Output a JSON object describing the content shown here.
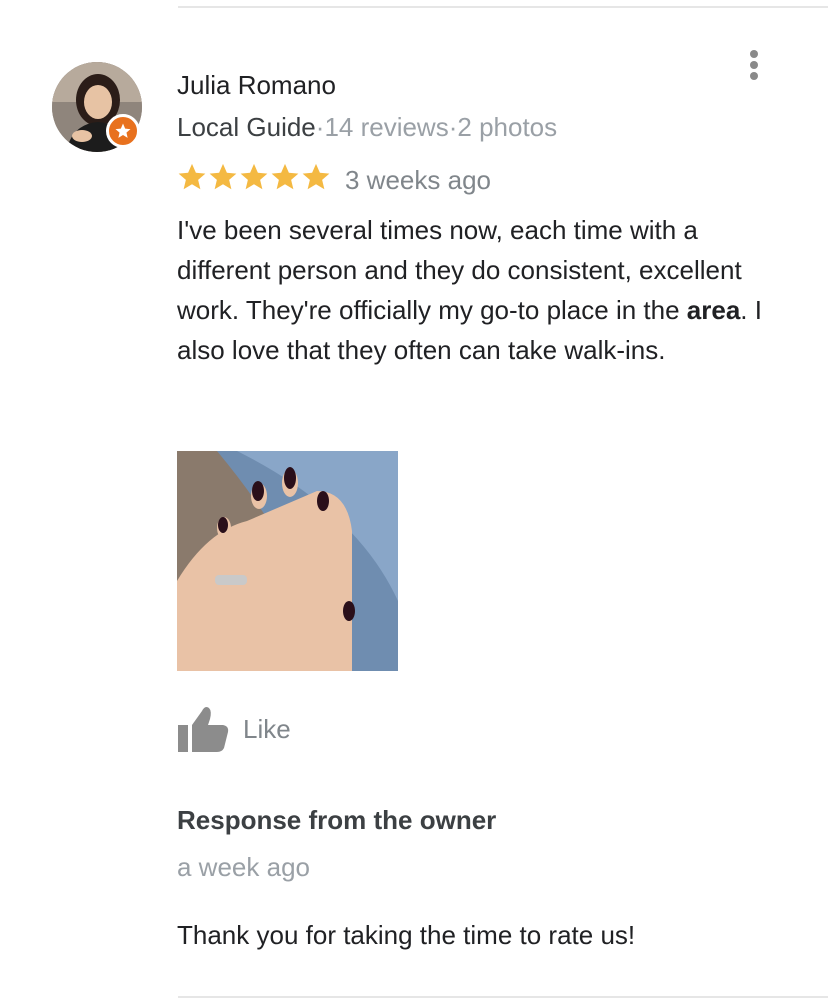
{
  "reviewer": {
    "name": "Julia Romano",
    "guide_label": "Local Guide",
    "separator": "·",
    "reviews_count": "14 reviews",
    "photos_count": "2 photos"
  },
  "review": {
    "rating": 5,
    "rating_max": 5,
    "date": "3 weeks ago",
    "text_before": "I've been several times now, each time with a different person and they do consistent, excellent work. They're officially my go-to place in the ",
    "text_highlight": "area",
    "text_after": ". I also love that they often can take walk-ins."
  },
  "actions": {
    "like_label": "Like"
  },
  "owner_response": {
    "title": "Response from the owner",
    "date": "a week ago",
    "text": "Thank you for taking the time to rate us!"
  },
  "colors": {
    "star": "#f4b942",
    "badge": "#e8711e",
    "muted": "#9aa0a6"
  },
  "icons": [
    "kebab-menu-icon",
    "star-icon",
    "thumbs-up-icon",
    "local-guide-badge-icon"
  ]
}
